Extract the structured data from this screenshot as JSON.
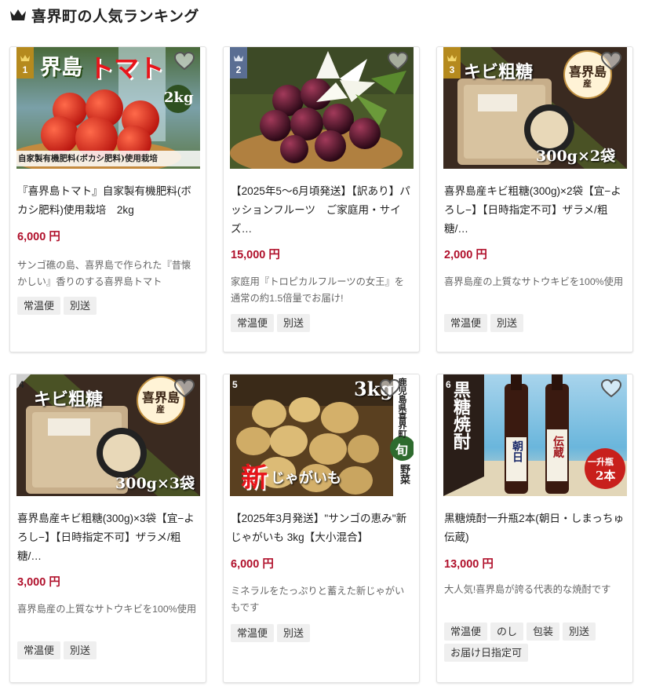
{
  "section": {
    "title": "喜界町の人気ランキング",
    "icon": "crown-icon"
  },
  "colors": {
    "price": "#b0102b",
    "rank_gold": "#b58a1e",
    "rank_blue": "#5a6e93",
    "tag_bg": "#efefef"
  },
  "products": [
    {
      "rank": "1",
      "image_text": [
        "界島",
        "トマト",
        "2kg",
        "自家製有機肥料(ボカシ肥料)使用栽培"
      ],
      "title": "『喜界島トマト』自家製有機肥料(ボカシ肥料)使用栽培　2kg",
      "price": "6,000 円",
      "desc": "サンゴ礁の島、喜界島で作られた『昔懐かしい』香りのする喜界島トマト",
      "tags": [
        "常温便",
        "別送"
      ]
    },
    {
      "rank": "2",
      "image_text": [],
      "title": "【2025年5～6月頃発送】【訳あり】パッションフルーツ　ご家庭用・サイズ…",
      "price": "15,000 円",
      "desc": "家庭用『トロピカルフルーツの女王』を通常の約1.5倍量でお届け!",
      "tags": [
        "常温便",
        "別送"
      ]
    },
    {
      "rank": "3",
      "image_text": [
        "キビ粗糖",
        "喜界島",
        "産",
        "300g×2袋"
      ],
      "title": "喜界島産キビ粗糖(300g)×2袋【宜−よろし−】【日時指定不可】ザラメ/粗糖/…",
      "price": "2,000 円",
      "desc": "喜界島産の上質なサトウキビを100%使用",
      "tags": [
        "常温便",
        "別送"
      ]
    },
    {
      "rank": "4",
      "image_text": [
        "キビ粗糖",
        "喜界島",
        "産",
        "300g×3袋"
      ],
      "title": "喜界島産キビ粗糖(300g)×3袋【宜−よろし−】【日時指定不可】ザラメ/粗糖/…",
      "price": "3,000 円",
      "desc": "喜界島産の上質なサトウキビを100%使用",
      "tags": [
        "常温便",
        "別送"
      ]
    },
    {
      "rank": "5",
      "image_text": [
        "3kg",
        "鹿児島県喜界町",
        "新",
        "じゃがいも",
        "旬",
        "野菜"
      ],
      "title": "【2025年3月発送】\"サンゴの恵み\"新じゃがいも 3kg【大小混合】",
      "price": "6,000 円",
      "desc": "ミネラルをたっぷりと蓄えた新じゃがいもです",
      "tags": [
        "常温便",
        "別送"
      ]
    },
    {
      "rank": "6",
      "image_text": [
        "黒糖焼酎",
        "朝日",
        "伝蔵",
        "一升瓶",
        "2本"
      ],
      "title": "黒糖焼酎一升瓶2本(朝日・しまっちゅ伝蔵)",
      "price": "13,000 円",
      "desc": "大人気!喜界島が誇る代表的な焼酎です",
      "tags": [
        "常温便",
        "のし",
        "包装",
        "別送",
        "お届け日指定可"
      ]
    }
  ]
}
